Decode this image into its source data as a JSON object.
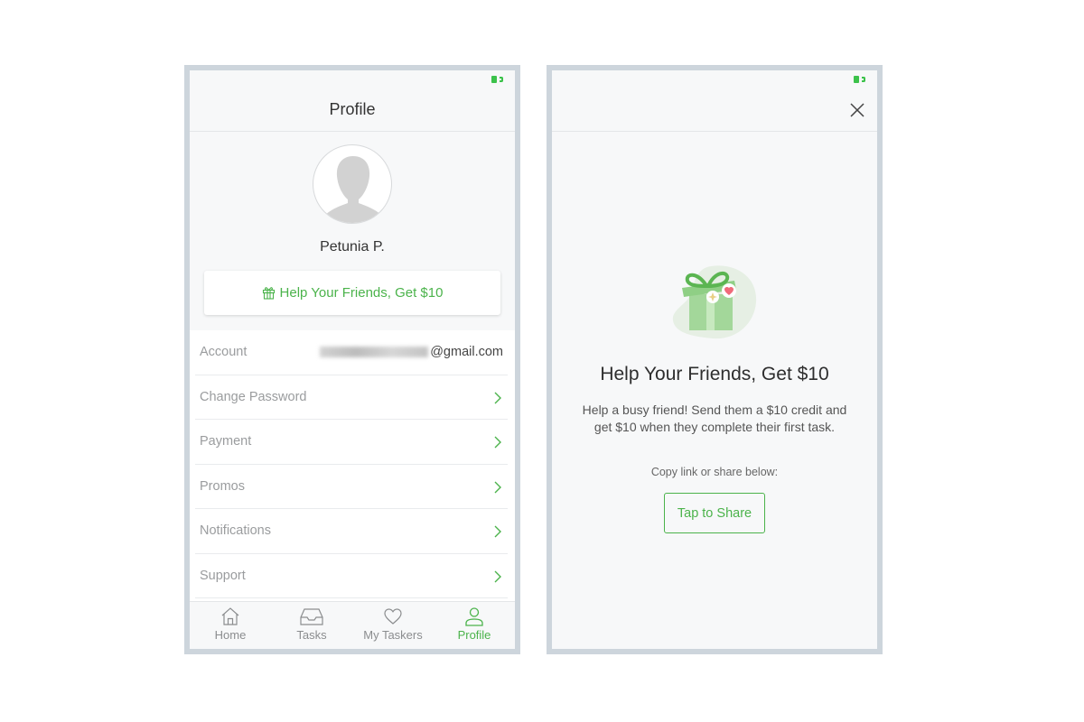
{
  "colors": {
    "accent": "#4bb34b",
    "frame": "#cdd5dc",
    "battery": "#3cc24b",
    "heart": "#f06a7a"
  },
  "left_screen": {
    "status_bar": {
      "battery_icon": "battery-icon"
    },
    "nav": {
      "title": "Profile"
    },
    "profile": {
      "avatar_icon": "person-silhouette-icon",
      "name": "Petunia P."
    },
    "invite_button": {
      "icon": "gift-icon",
      "label": "Help Your Friends, Get $10"
    },
    "menu": {
      "items": [
        {
          "label": "Account",
          "value_suffix": "@gmail.com",
          "value_redacted": true
        },
        {
          "label": "Change Password",
          "icon": "chevron-right-icon"
        },
        {
          "label": "Payment",
          "icon": "chevron-right-icon"
        },
        {
          "label": "Promos",
          "icon": "chevron-right-icon"
        },
        {
          "label": "Notifications",
          "icon": "chevron-right-icon"
        },
        {
          "label": "Support",
          "icon": "chevron-right-icon"
        }
      ]
    },
    "tabbar": {
      "tabs": [
        {
          "label": "Home",
          "icon": "home-icon",
          "active": false
        },
        {
          "label": "Tasks",
          "icon": "inbox-tray-icon",
          "active": false
        },
        {
          "label": "My Taskers",
          "icon": "heart-icon",
          "active": false
        },
        {
          "label": "Profile",
          "icon": "person-icon",
          "active": true
        }
      ]
    }
  },
  "right_screen": {
    "status_bar": {
      "battery_icon": "battery-icon"
    },
    "nav": {
      "close_icon": "close-icon"
    },
    "referral": {
      "illustration": "gift-box-illustration",
      "title": "Help Your Friends, Get $10",
      "body": "Help a busy friend! Send them a $10 credit and get $10 when they complete their first task.",
      "copy_hint": "Copy link or share below:",
      "share_button": "Tap to Share"
    }
  }
}
